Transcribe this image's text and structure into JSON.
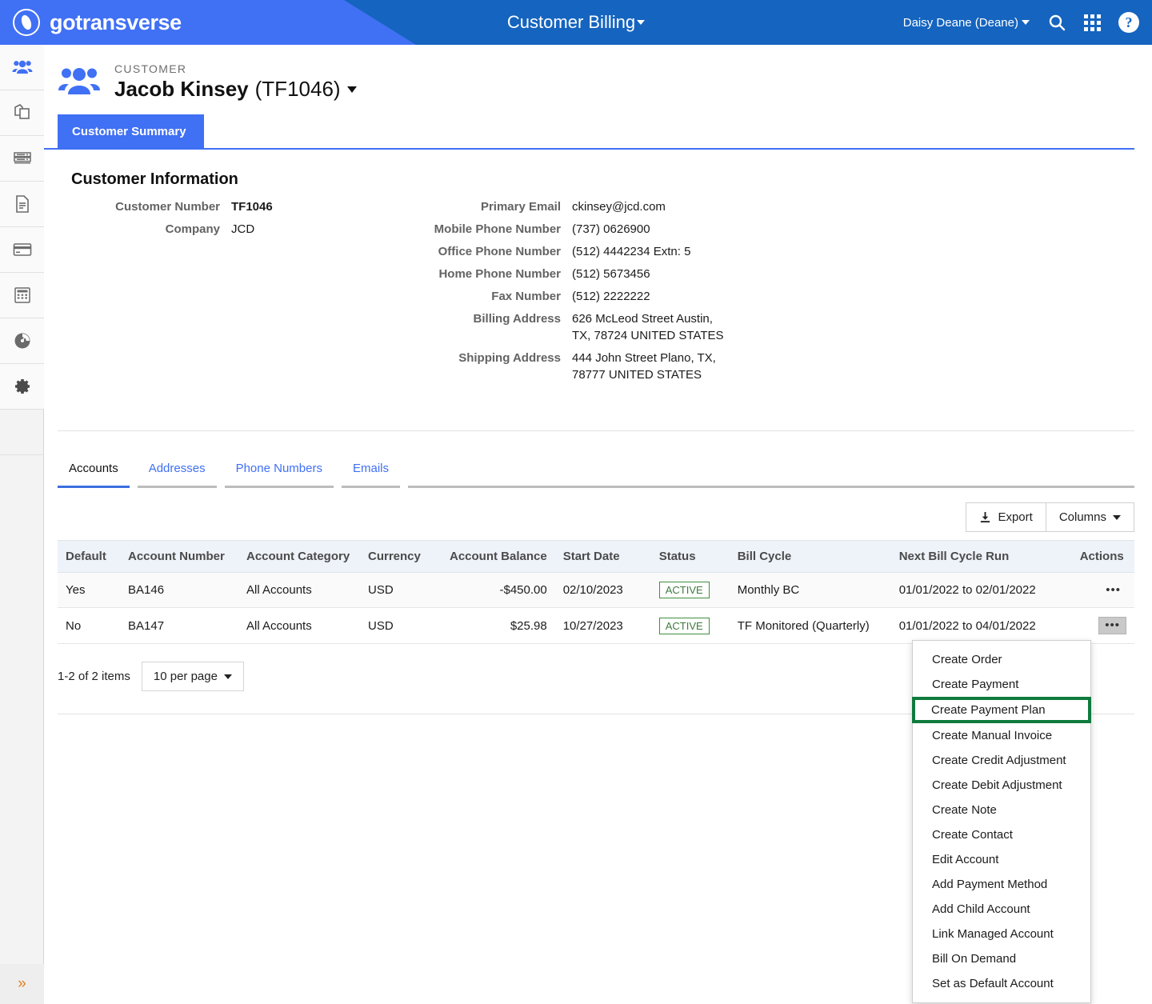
{
  "header": {
    "brand": "gotransverse",
    "brand_logo_icon": "gotransverse-logo-icon",
    "page_title": "Customer Billing",
    "user": "Daisy Deane (Deane)",
    "search_icon": "search-icon",
    "apps_icon": "apps-grid-icon",
    "help_icon": "help-circle-icon"
  },
  "sidebar": {
    "items": [
      {
        "icon": "customers-people-icon",
        "active": true
      },
      {
        "icon": "products-copy-icon",
        "active": false
      },
      {
        "icon": "rates-server-icon",
        "active": false
      },
      {
        "icon": "documents-file-icon",
        "active": false
      },
      {
        "icon": "payments-credit-card-icon",
        "active": false
      },
      {
        "icon": "billing-calculator-icon",
        "active": false
      },
      {
        "icon": "reports-gauge-icon",
        "active": false
      },
      {
        "icon": "settings-gear-icon",
        "active": false
      }
    ],
    "expand_icon": "double-chevron-right-icon"
  },
  "customer": {
    "eyebrow": "CUSTOMER",
    "name": "Jacob Kinsey",
    "number_paren": "(TF1046)",
    "summary_tab": "Customer Summary"
  },
  "customer_information": {
    "section_title": "Customer Information",
    "left": [
      {
        "label": "Customer Number",
        "value": "TF1046",
        "bold": true
      },
      {
        "label": "Company",
        "value": "JCD",
        "bold": false
      }
    ],
    "right": [
      {
        "label": "Primary Email",
        "value": "ckinsey@jcd.com"
      },
      {
        "label": "Mobile Phone Number",
        "value": "(737) 0626900"
      },
      {
        "label": "Office Phone Number",
        "value": "(512) 4442234 Extn: 5"
      },
      {
        "label": "Home Phone Number",
        "value": "(512) 5673456"
      },
      {
        "label": "Fax Number",
        "value": "(512) 2222222"
      },
      {
        "label": "Billing Address",
        "value": "626 McLeod Street Austin, TX, 78724 UNITED STATES"
      },
      {
        "label": "Shipping Address",
        "value": "444 John Street Plano, TX, 78777 UNITED STATES"
      }
    ]
  },
  "subtabs": [
    {
      "label": "Accounts",
      "active": true
    },
    {
      "label": "Addresses",
      "active": false
    },
    {
      "label": "Phone Numbers",
      "active": false
    },
    {
      "label": "Emails",
      "active": false
    }
  ],
  "toolbar": {
    "export_label": "Export",
    "export_icon": "download-icon",
    "columns_label": "Columns",
    "columns_caret_icon": "caret-down-icon"
  },
  "table": {
    "columns": [
      "Default",
      "Account Number",
      "Account Category",
      "Currency",
      "Account Balance",
      "Start Date",
      "Status",
      "Bill Cycle",
      "Next Bill Cycle Run",
      "Actions"
    ],
    "rows": [
      {
        "default": "Yes",
        "account_number": "BA146",
        "account_category": "All Accounts",
        "currency": "USD",
        "account_balance": "-$450.00",
        "start_date": "02/10/2023",
        "status": "ACTIVE",
        "bill_cycle": "Monthly BC",
        "next_bill_cycle_run": "01/01/2022 to 02/01/2022",
        "actions_icon": "ellipsis-icon"
      },
      {
        "default": "No",
        "account_number": "BA147",
        "account_category": "All Accounts",
        "currency": "USD",
        "account_balance": "$25.98",
        "start_date": "10/27/2023",
        "status": "ACTIVE",
        "bill_cycle": "TF Monitored (Quarterly)",
        "next_bill_cycle_run": "01/01/2022 to 04/01/2022",
        "actions_icon": "ellipsis-icon"
      }
    ]
  },
  "pager": {
    "items_text": "1-2 of 2 items",
    "per_page": "10 per page"
  },
  "actions_menu": {
    "items": [
      {
        "label": "Create Order",
        "highlight": false
      },
      {
        "label": "Create Payment",
        "highlight": false
      },
      {
        "label": "Create Payment Plan",
        "highlight": true
      },
      {
        "label": "Create Manual Invoice",
        "highlight": false
      },
      {
        "label": "Create Credit Adjustment",
        "highlight": false
      },
      {
        "label": "Create Debit Adjustment",
        "highlight": false
      },
      {
        "label": "Create Note",
        "highlight": false
      },
      {
        "label": "Create Contact",
        "highlight": false
      },
      {
        "label": "Edit Account",
        "highlight": false
      },
      {
        "label": "Add Payment Method",
        "highlight": false
      },
      {
        "label": "Add Child Account",
        "highlight": false
      },
      {
        "label": "Link Managed Account",
        "highlight": false
      },
      {
        "label": "Bill On Demand",
        "highlight": false
      },
      {
        "label": "Set as Default Account",
        "highlight": false
      }
    ],
    "highlight_color": "#0f7a3d"
  },
  "colors": {
    "header_blue": "#1564bf",
    "accent_blue": "#4070f4",
    "status_green": "#3f8f3f"
  }
}
